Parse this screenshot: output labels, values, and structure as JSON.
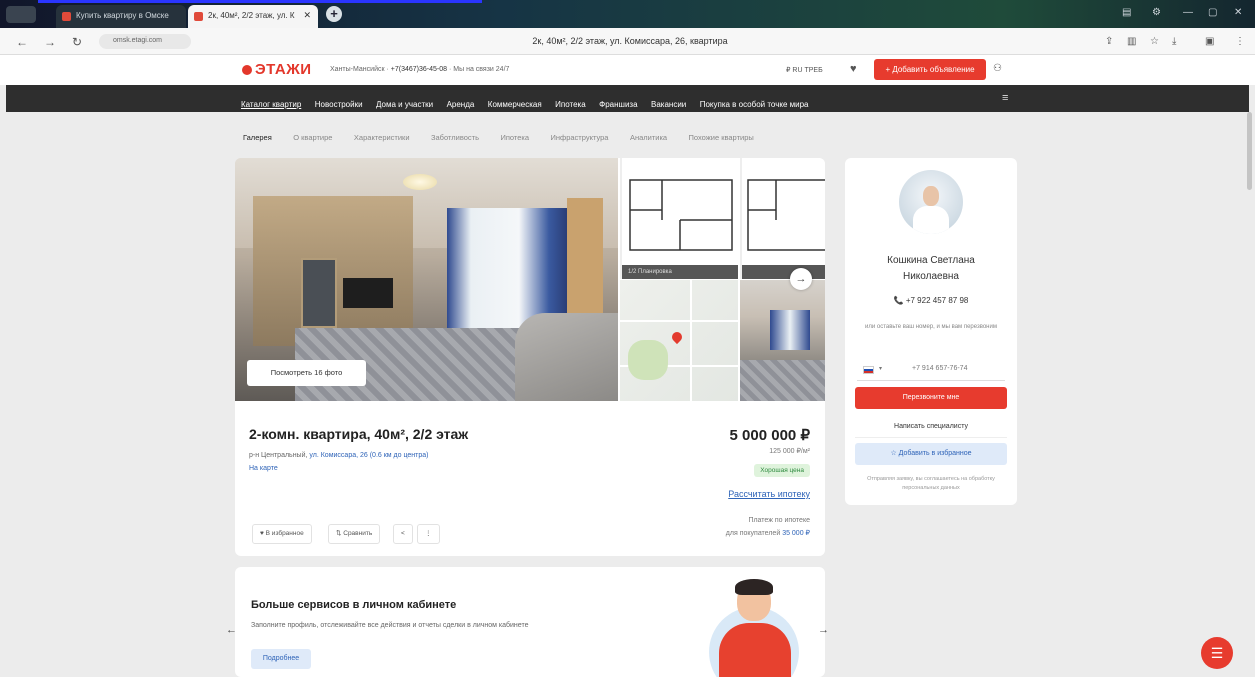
{
  "browser": {
    "tabs": [
      {
        "label": "Купить квартиру в Омске"
      },
      {
        "label": "2к, 40м², 2/2 этаж, ул. К"
      }
    ],
    "new_tab": "+",
    "url": "omsk.etagi.com",
    "page_title": "2к, 40м², 2/2 этаж, ул. Комиссара, 26, квартира"
  },
  "header": {
    "logo": "ЭТАЖИ",
    "city": "Ханты-Мансийск",
    "phone": "+7(3467)36-45-08",
    "hours": "Мы на связи 24/7",
    "currency": "₽ RU ТРЕБ",
    "add_button": "+ Добавить объявление"
  },
  "nav": {
    "items": [
      "Каталог квартир",
      "Новостройки",
      "Дома и участки",
      "Аренда",
      "Коммерческая",
      "Ипотека",
      "Франшиза",
      "Вакансии",
      "Покупка в особой точке мира"
    ]
  },
  "subtabs": [
    "Галерея",
    "О квартире",
    "Характеристики",
    "Заботливость",
    "Ипотека",
    "Инфраструктура",
    "Аналитика",
    "Похожие квартиры"
  ],
  "listing": {
    "photo_all": "Посмотреть 16 фото",
    "plan_caption_1": "1/2 Планировка",
    "plan_caption_2": "",
    "title": "2-комн. квартира, 40м², 2/2 этаж",
    "address_prefix": "р-н Центральный,",
    "address_link": "ул. Комиссара, 26 (0.6 км до центра)",
    "map_link": "На карте",
    "price": "5 000 000 ₽",
    "price_per_m": "125 000 ₽/м²",
    "badge": "Хорошая цена",
    "mortgage_link": "Рассчитать ипотеку",
    "monthly_line1": "Платеж по ипотеке",
    "monthly_line2_prefix": "для покупателей",
    "monthly_value": "35 000 ₽",
    "actions": [
      "♥ В избранное",
      "⇅ Сравнить",
      "<",
      "⋮"
    ]
  },
  "promo": {
    "title": "Больше сервисов в личном кабинете",
    "text": "Заполните профиль, отслеживайте все действия и отчеты сделки в личном кабинете",
    "button": "Подробнее"
  },
  "agent": {
    "name_line1": "Кошкина Светлана",
    "name_line2": "Николаевна",
    "phone": "📞 +7 922 457 87 98",
    "note": "или оставьте ваш номер, и мы вам перезвоним",
    "flag_caret": "▾",
    "phone_input": "+7 914 657-76-74",
    "call_button": "Перезвоните мне",
    "write_button": "Написать специалисту",
    "fav_button": "☆ Добавить в избранное",
    "footer": "Отправляя заявку, вы соглашаетесь на обработку персональных данных"
  },
  "fab": "☰"
}
